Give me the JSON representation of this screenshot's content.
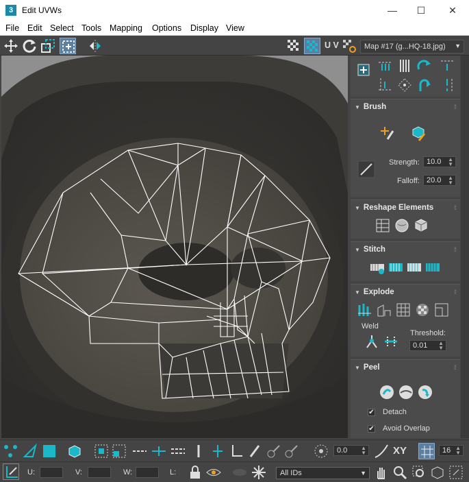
{
  "window": {
    "title": "Edit UVWs",
    "app_icon_text": "3",
    "minimize": "—",
    "maximize": "☐",
    "close": "✕"
  },
  "menu": [
    "File",
    "Edit",
    "Select",
    "Tools",
    "Mapping",
    "Options",
    "Display",
    "View"
  ],
  "toolbar": {
    "uv_label": "U V",
    "map_dropdown": "Map #17 (g...HQ-18.jpg)"
  },
  "panel": {
    "brush": {
      "title": "Brush",
      "strength_label": "Strength:",
      "strength_value": "10.0",
      "falloff_label": "Falloff:",
      "falloff_value": "20.0"
    },
    "reshape": {
      "title": "Reshape Elements"
    },
    "stitch": {
      "title": "Stitch"
    },
    "explode": {
      "title": "Explode",
      "weld_label": "Weld",
      "threshold_label": "Threshold:",
      "threshold_value": "0.01"
    },
    "peel": {
      "title": "Peel",
      "detach_label": "Detach",
      "detach_checked": true,
      "avoid_overlap_label": "Avoid Overlap",
      "avoid_overlap_checked": true
    }
  },
  "bottom": {
    "angle_value": "0.0",
    "xy_label": "XY",
    "grid_value": "16",
    "u_label": "U:",
    "v_label": "V:",
    "w_label": "W:",
    "l_label": "L:",
    "ids_select": "All IDs"
  },
  "colors": {
    "accent": "#1ab8c8",
    "panel_bg": "#444444",
    "wire": "#ffffff"
  }
}
